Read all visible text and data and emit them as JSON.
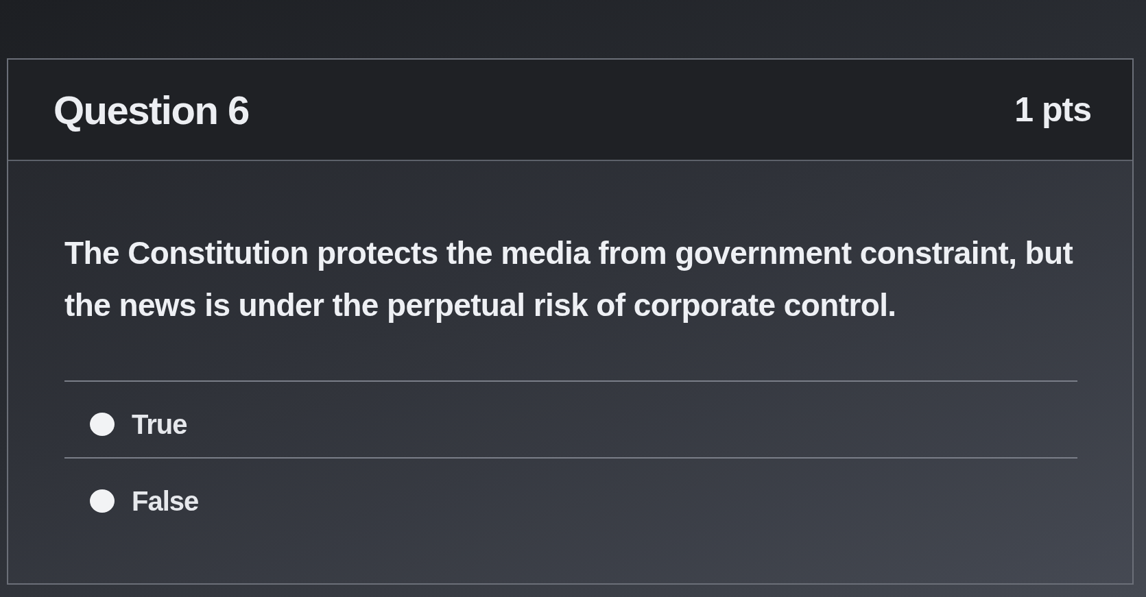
{
  "question": {
    "title": "Question 6",
    "points": "1 pts",
    "text": "The Constitution protects the media from government constraint, but the news is under the perpetual risk of corporate control."
  },
  "answers": [
    {
      "label": "True",
      "selected": false
    },
    {
      "label": "False",
      "selected": false
    }
  ]
}
